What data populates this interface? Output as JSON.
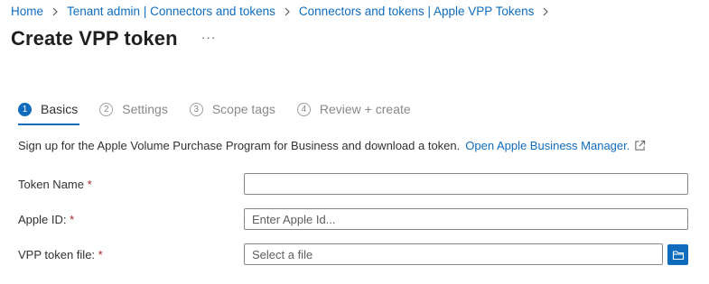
{
  "breadcrumb": {
    "items": [
      "Home",
      "Tenant admin | Connectors and tokens",
      "Connectors and tokens | Apple VPP Tokens"
    ]
  },
  "header": {
    "title": "Create VPP token",
    "more_label": "···"
  },
  "steps": [
    {
      "number": "1",
      "label": "Basics",
      "active": true
    },
    {
      "number": "2",
      "label": "Settings",
      "active": false
    },
    {
      "number": "3",
      "label": "Scope tags",
      "active": false
    },
    {
      "number": "4",
      "label": "Review + create",
      "active": false
    }
  ],
  "intro": {
    "text": "Sign up for the Apple Volume Purchase Program for Business and download a token.",
    "link": "Open Apple Business Manager."
  },
  "form": {
    "token_name": {
      "label": "Token Name",
      "required_mark": "*",
      "value": "",
      "placeholder": ""
    },
    "apple_id": {
      "label": "Apple ID:",
      "required_mark": "*",
      "value": "",
      "placeholder": "Enter Apple Id..."
    },
    "vpp_file": {
      "label": "VPP token file:",
      "required_mark": "*",
      "placeholder": "Select a file"
    }
  },
  "icons": {
    "breadcrumb_separator": "chevron-right-icon",
    "external_link": "external-link-icon",
    "browse": "folder-icon"
  },
  "colors": {
    "accent": "#0f6cbd",
    "required": "#a4262c",
    "muted": "#8a8886"
  }
}
